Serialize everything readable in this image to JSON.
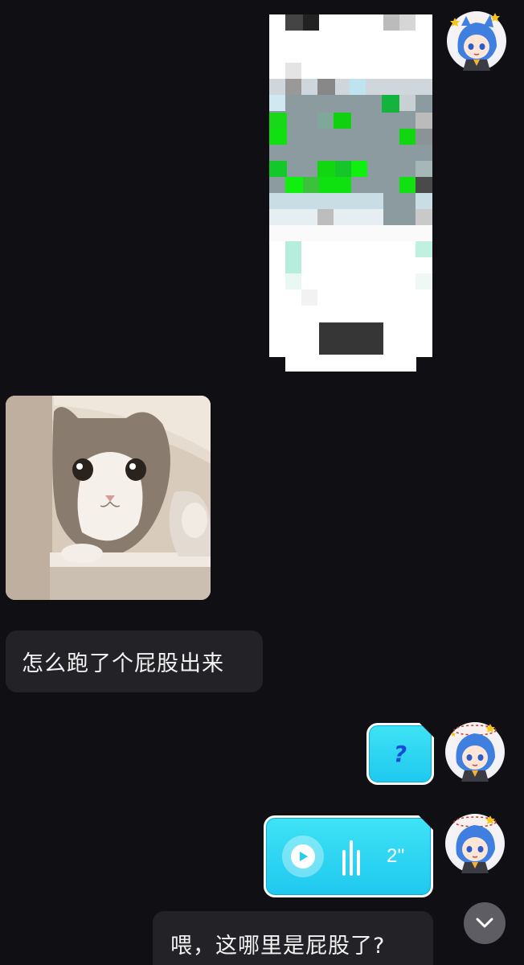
{
  "messages": {
    "received_text_1": "怎么跑了个屁股出来",
    "sent_question": "?",
    "voice_duration": "2''",
    "received_text_2": "喂，这哪里是屁股了?"
  },
  "icons": {
    "play": "play-icon",
    "scroll": "chevron-down-icon",
    "waveform": "waveform-icon",
    "avatar": "anime-avatar"
  },
  "colors": {
    "background": "#0f0f14",
    "bubble_received": "#232327",
    "bubble_sent": "#2dd6f2",
    "text": "#f2f2f2"
  }
}
